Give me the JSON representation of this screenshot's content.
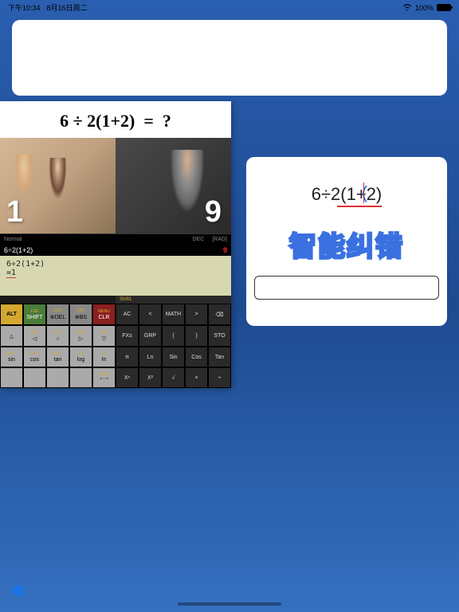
{
  "status": {
    "time": "下午10:34",
    "date": "8月16日周二",
    "battery_pct": "100%"
  },
  "meme": {
    "equation": "6 ÷ 2(1+2)  =  ?",
    "answer_left": "1",
    "answer_right": "9"
  },
  "calc": {
    "bar": {
      "normal": "Normal",
      "dec": "DEC",
      "rad": "[RAD]"
    },
    "result_expr": "6÷2(1+2)",
    "result_val": "9",
    "screen_expr": "6÷2(1+2)",
    "screen_ans": "=1",
    "shift_label": "Shift1",
    "rows": [
      [
        {
          "sup": "",
          "lbl": "ALT",
          "cls": "yellow"
        },
        {
          "sup": "FSE",
          "lbl": "SHIFT",
          "cls": "green"
        },
        {
          "sup": "DIGS",
          "lbl": "⊕DEL",
          "cls": "gray"
        },
        {
          "sup": "DRG",
          "lbl": "⊕BS",
          "cls": "gray"
        },
        {
          "sup": "MENU",
          "lbl": "CLR",
          "cls": "red"
        },
        {
          "sup": "",
          "lbl": "AC",
          "cls": "dark"
        },
        {
          "sup": "",
          "lbl": "<",
          "cls": "dark"
        },
        {
          "sup": "",
          "lbl": "MATH",
          "cls": "dark"
        },
        {
          "sup": "",
          "lbl": ">",
          "cls": "dark"
        },
        {
          "sup": "",
          "lbl": "⌫",
          "cls": "dark"
        }
      ],
      [
        {
          "sup": "",
          "lbl": "△",
          "cls": "lgray"
        },
        {
          "sup": "HEX",
          "lbl": "◁",
          "cls": "lgray"
        },
        {
          "sup": "OCT",
          "lbl": "○",
          "cls": "lgray"
        },
        {
          "sup": "BIN",
          "lbl": "▷",
          "cls": "lgray"
        },
        {
          "sup": "abs",
          "lbl": "▽",
          "cls": "lgray"
        },
        {
          "sup": "",
          "lbl": "FXs",
          "cls": "dark"
        },
        {
          "sup": "",
          "lbl": "GRP",
          "cls": "dark"
        },
        {
          "sup": "",
          "lbl": "(",
          "cls": "dark"
        },
        {
          "sup": "",
          "lbl": ")",
          "cls": "dark"
        },
        {
          "sup": "",
          "lbl": "STO",
          "cls": "dark"
        }
      ],
      [
        {
          "sup": "sin⁻¹",
          "lbl": "sin",
          "cls": "lgray"
        },
        {
          "sup": "cos⁻¹",
          "lbl": "cos",
          "cls": "lgray"
        },
        {
          "sup": "tan⁻¹",
          "lbl": "tan",
          "cls": "lgray"
        },
        {
          "sup": "10ˣ",
          "lbl": "log",
          "cls": "lgray"
        },
        {
          "sup": "eˣ",
          "lbl": "In",
          "cls": "lgray"
        },
        {
          "sup": "",
          "lbl": "π",
          "cls": "dark"
        },
        {
          "sup": "",
          "lbl": "Ln",
          "cls": "dark"
        },
        {
          "sup": "",
          "lbl": "Sin",
          "cls": "dark"
        },
        {
          "sup": "",
          "lbl": "Cos",
          "cls": "dark"
        },
        {
          "sup": "",
          "lbl": "Tan",
          "cls": "dark"
        }
      ],
      [
        {
          "sup": "",
          "lbl": "",
          "cls": "lgray"
        },
        {
          "sup": "",
          "lbl": "",
          "cls": "lgray"
        },
        {
          "sup": "",
          "lbl": "",
          "cls": "lgray"
        },
        {
          "sup": "",
          "lbl": "",
          "cls": "lgray"
        },
        {
          "sup": "H:M:S",
          "lbl": "° ' \"",
          "cls": "lgray"
        },
        {
          "sup": "",
          "lbl": "Xⁿ",
          "cls": "dark"
        },
        {
          "sup": "",
          "lbl": "X²",
          "cls": "dark"
        },
        {
          "sup": "",
          "lbl": "√",
          "cls": "dark"
        },
        {
          "sup": "",
          "lbl": "×",
          "cls": "dark"
        },
        {
          "sup": "",
          "lbl": "÷",
          "cls": "dark"
        }
      ]
    ]
  },
  "right_card": {
    "expr": "6÷2(1+2)",
    "feature": "智能纠错"
  }
}
